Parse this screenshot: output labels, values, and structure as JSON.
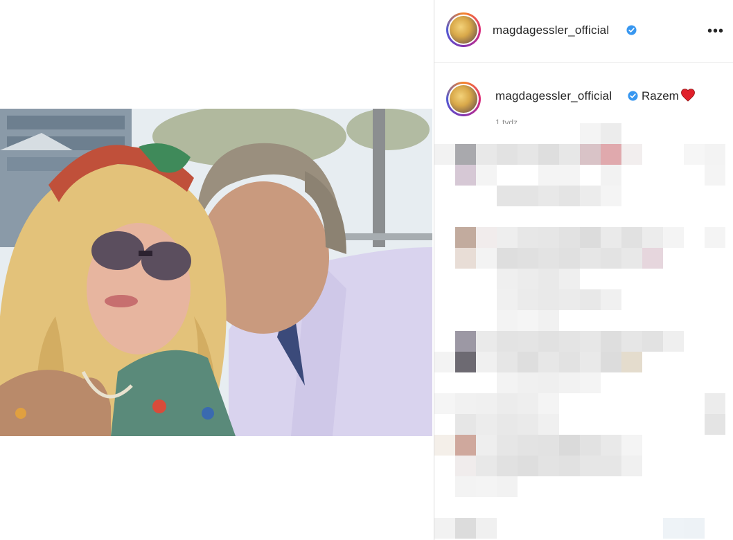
{
  "post": {
    "author": {
      "username": "magdagessler_official",
      "verified": true,
      "avatar_icon": "profile-avatar"
    },
    "header": {
      "more_label": "•••"
    },
    "caption": {
      "username": "magdagessler_official",
      "text": "Razem",
      "emoji": "red-heart-icon",
      "timestamp": "1 tydz."
    },
    "media": {
      "type": "photo"
    },
    "comments": {
      "state": "pixelated"
    }
  },
  "colors": {
    "verified_blue": "#3897f0",
    "heart_red": "#e0202a",
    "text_primary": "#262626",
    "text_secondary": "#8e8e8e",
    "border": "#dbdbdb"
  }
}
